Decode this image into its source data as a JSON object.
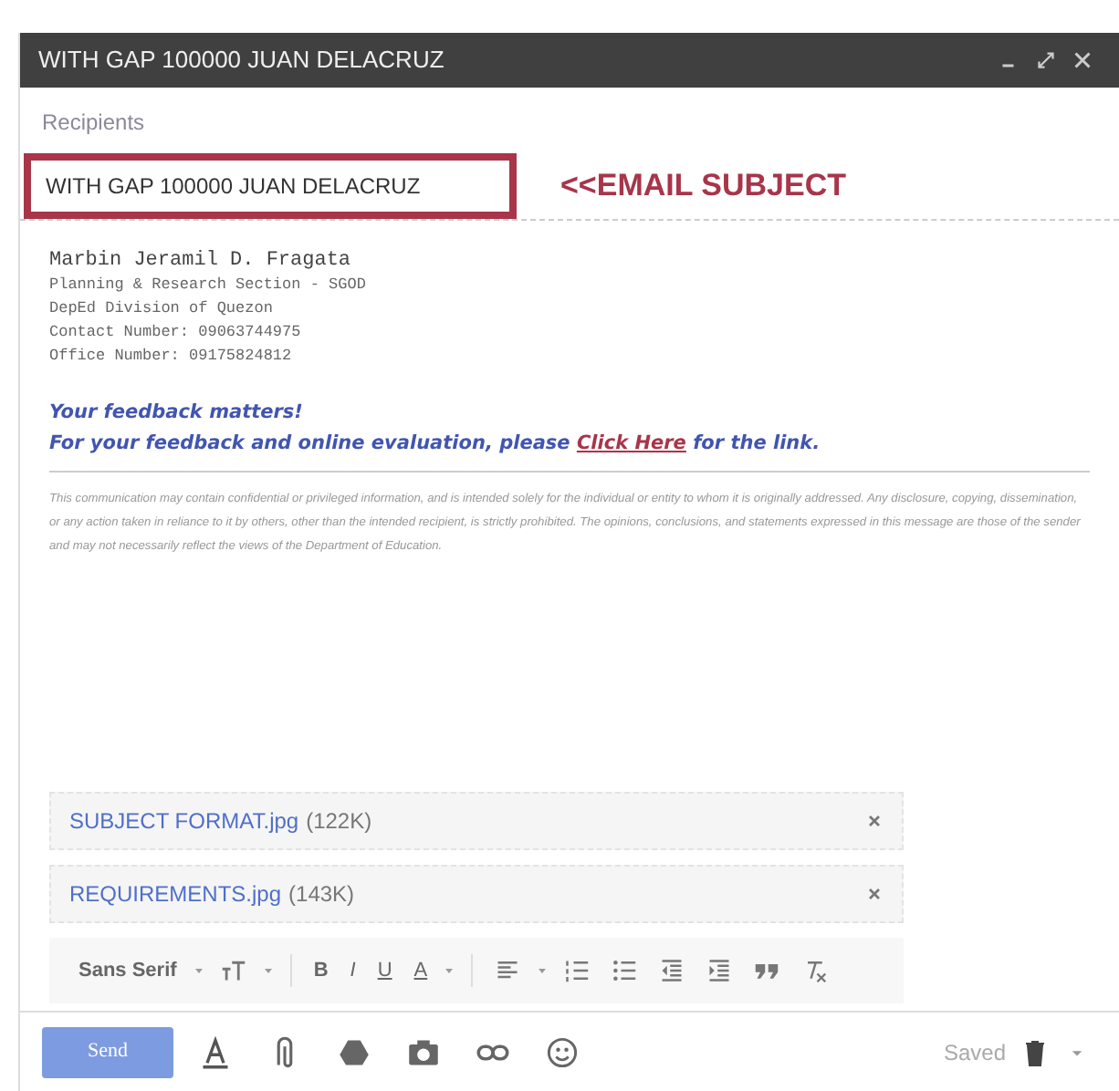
{
  "window": {
    "title": "WITH GAP 100000 JUAN DELACRUZ",
    "controls": [
      {
        "kind": "minimize"
      },
      {
        "kind": "maximize"
      },
      {
        "kind": "close"
      }
    ]
  },
  "recipients": {
    "placeholder": "Recipients"
  },
  "subject": {
    "value": "WITH GAP 100000 JUAN DELACRUZ",
    "annotation": "<<EMAIL SUBJECT"
  },
  "signature": [
    {
      "kind": "name",
      "text": "Marbin Jeramil D. Fragata"
    },
    {
      "kind": "line",
      "text": "Planning & Research Section - SGOD"
    },
    {
      "kind": "line",
      "text": "DepEd Division of Quezon"
    },
    {
      "kind": "line",
      "text": "Contact Number: 09063744975"
    },
    {
      "kind": "line",
      "text": "Office Number: 09175824812"
    }
  ],
  "feedback": {
    "heading": "Your feedback matters!",
    "before": "For your feedback and online evaluation, please ",
    "link": "Click Here",
    "after": " for the link."
  },
  "disclaimer": "This communication may contain confidential or privileged information, and is intended solely for the individual or entity to whom it is originally addressed. Any disclosure, copying, dissemination, or any action taken in reliance to it by others, other than the intended recipient, is strictly prohibited. The opinions, conclusions, and statements expressed in this message are those of the sender and may not necessarily reflect the views of the Department of Education.",
  "attachments": [
    {
      "name": "SUBJECT FORMAT.jpg",
      "size": "(122K)"
    },
    {
      "name": "REQUIREMENTS.jpg",
      "size": "(143K)"
    }
  ],
  "format_toolbar": [
    {
      "kind": "font",
      "label": "Sans Serif"
    },
    {
      "kind": "size"
    },
    {
      "kind": "sep"
    },
    {
      "kind": "bold",
      "label": "B"
    },
    {
      "kind": "italic",
      "label": "I"
    },
    {
      "kind": "underline",
      "label": "U"
    },
    {
      "kind": "color",
      "label": "A"
    },
    {
      "kind": "sep"
    },
    {
      "kind": "align"
    },
    {
      "kind": "numbered"
    },
    {
      "kind": "bulleted"
    },
    {
      "kind": "outdent"
    },
    {
      "kind": "indent"
    },
    {
      "kind": "quote"
    },
    {
      "kind": "clear"
    }
  ],
  "bottom_bar": {
    "send": "Send",
    "tools": [
      {
        "kind": "formatting"
      },
      {
        "kind": "attach"
      },
      {
        "kind": "drive"
      },
      {
        "kind": "photo"
      },
      {
        "kind": "link"
      },
      {
        "kind": "emoji"
      }
    ],
    "status": "Saved"
  }
}
